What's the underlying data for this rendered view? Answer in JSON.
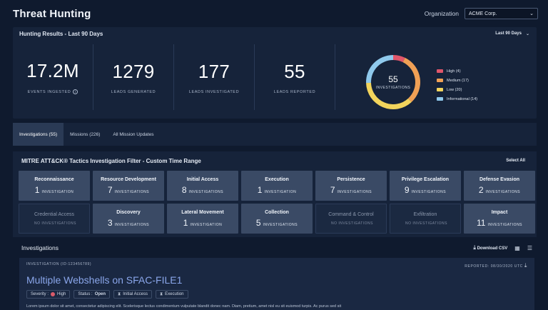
{
  "header": {
    "title": "Threat Hunting",
    "org_label": "Organization",
    "org_value": "ACME Corp.",
    "chevron": "⌄"
  },
  "results": {
    "title": "Hunting Results - Last 90 Days",
    "range_label": "Last 90 Days",
    "stats": [
      {
        "value": "17.2M",
        "label": "EVENTS INGESTED"
      },
      {
        "value": "1279",
        "label": "LEADS GENERATED"
      },
      {
        "value": "177",
        "label": "LEADS INVESTIGATED"
      },
      {
        "value": "55",
        "label": "LEADS REPORTED"
      }
    ],
    "info_glyph": "i",
    "donut": {
      "total": "55",
      "label": "INVESTIGATIONS",
      "segments": [
        {
          "name": "High",
          "count": 4,
          "color": "#e0566a"
        },
        {
          "name": "Medium",
          "count": 17,
          "color": "#f0a055"
        },
        {
          "name": "Low",
          "count": 20,
          "color": "#f2d45c"
        },
        {
          "name": "Informational",
          "count": 14,
          "color": "#8fc9ec"
        }
      ],
      "legend": [
        "High (4)",
        "Medium (17)",
        "Low (20)",
        "Informational (14)"
      ]
    }
  },
  "tabs": [
    "Investigations (55)",
    "Missions (226)",
    "All Mission Updates"
  ],
  "mitre": {
    "title": "MITRE ATT&CK® Tactics Investigation Filter - Custom Time Range",
    "select_all": "Select All",
    "tiles": [
      {
        "name": "Reconnaissance",
        "num": "1",
        "unit": "INVESTIGATION"
      },
      {
        "name": "Resource Development",
        "num": "7",
        "unit": "INVESTIGATIONS"
      },
      {
        "name": "Initial Access",
        "num": "8",
        "unit": "INVESTIGATIONS"
      },
      {
        "name": "Execution",
        "num": "1",
        "unit": "INVESTIGATION"
      },
      {
        "name": "Persistence",
        "num": "7",
        "unit": "INVESTIGATIONS"
      },
      {
        "name": "Privilege Escalation",
        "num": "9",
        "unit": "INVESTIGATIONS"
      },
      {
        "name": "Defense Evasion",
        "num": "2",
        "unit": "INVESTIGATIONS"
      },
      {
        "name": "Credential Access",
        "num": "",
        "unit": "NO INVESTIGATIONS"
      },
      {
        "name": "Discovery",
        "num": "3",
        "unit": "INVESTIGATIONS"
      },
      {
        "name": "Lateral Movement",
        "num": "1",
        "unit": "INVESTIGATION"
      },
      {
        "name": "Collection",
        "num": "5",
        "unit": "INVESTIGATIONS"
      },
      {
        "name": "Command & Control",
        "num": "",
        "unit": "NO INVESTIGATIONS"
      },
      {
        "name": "Exfiltration",
        "num": "",
        "unit": "NO INVESTIGATIONS"
      },
      {
        "name": "Impact",
        "num": "11",
        "unit": "INVESTIGATIONS"
      }
    ]
  },
  "investigations": {
    "title": "Investigations",
    "download": "Download CSV",
    "grid_icon": "▦",
    "list_icon": "☰",
    "download_icon": "⤓",
    "card": {
      "id_label": "INVESTIGATION (ID:123456789)",
      "reported": "REPORTED: 08/30/2020 UTC",
      "title": "Multiple Webshells on SFAC-FILE1",
      "severity_label": "Severity :",
      "severity_value": "High",
      "status_label": "Status :",
      "status_value": "Open",
      "tactic_1": "Initial Access",
      "tactic_2": "Execution",
      "description": "Lorem ipsum dolor sit amet, consectetur adipiscing elit. Scelerisque lectus condimentum vulputate blandit donec nam. Diam, pretium, amet nisl eu sit euismod turpis. Ac purus sed sit"
    }
  }
}
